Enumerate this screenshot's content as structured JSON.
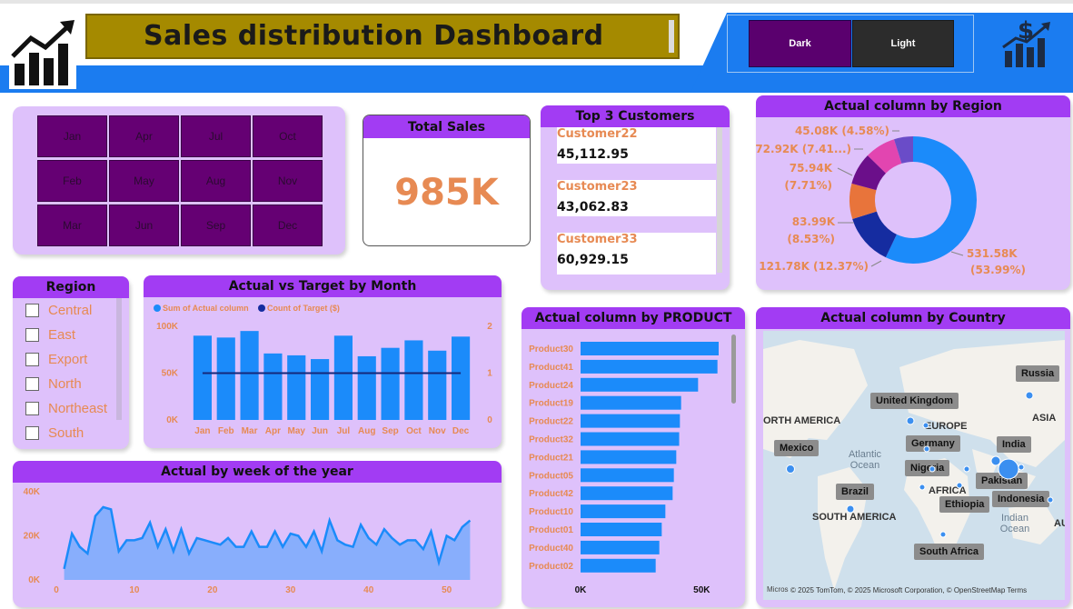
{
  "header": {
    "title": "Sales distribution Dashboard",
    "theme_dark": "Dark",
    "theme_light": "Light"
  },
  "colors": {
    "accent": "#a23cf3",
    "panel": "#dec1fb",
    "month_tile": "#650073",
    "bar": "#1b8bfa",
    "label": "#e78a53",
    "title_bar": "#a58a00"
  },
  "months": {
    "cols": [
      [
        "Jan",
        "Feb",
        "Mar"
      ],
      [
        "Apr",
        "May",
        "Jun"
      ],
      [
        "Jul",
        "Aug",
        "Sep"
      ],
      [
        "Oct",
        "Nov",
        "Dec"
      ]
    ]
  },
  "total_sales": {
    "title": "Total Sales",
    "value": "985K"
  },
  "top_customers": {
    "title": "Top 3 Customers",
    "items": [
      {
        "name": "Customer22",
        "value": "45,112.95"
      },
      {
        "name": "Customer23",
        "value": "43,062.83"
      },
      {
        "name": "Customer33",
        "value": "60,929.15"
      }
    ]
  },
  "region_slicer": {
    "title": "Region",
    "items": [
      "Central",
      "East",
      "Export",
      "North",
      "Northeast",
      "South"
    ]
  },
  "region_donut": {
    "title": "Actual column by Region",
    "labels": [
      "45.08K (4.58%)",
      "72.92K (7.41...)",
      "75.94K",
      "(7.71%)",
      "83.99K",
      "(8.53%)",
      "121.78K (12.37%)",
      "531.58K",
      "(53.99%)"
    ]
  },
  "product_chart": {
    "title": "Actual column by PRODUCT"
  },
  "country_map": {
    "title": "Actual column by Country",
    "countries": [
      "Russia",
      "United Kingdom",
      "Germany",
      "India",
      "Mexico",
      "Nigeria",
      "Pakistan",
      "Indonesia",
      "Brazil",
      "Ethiopia",
      "South Africa"
    ],
    "regions": [
      "ORTH AMERICA",
      "EUROPE",
      "ASIA",
      "AFRICA",
      "SOUTH AMERICA",
      "AU"
    ],
    "oceans": [
      "Atlantic Ocean",
      "Indian Ocean"
    ],
    "attribution": "© 2025 TomTom, © 2025 Microsoft Corporation, © OpenStreetMap  Terms",
    "brand": "Micros"
  },
  "chart_data": [
    {
      "type": "bar",
      "title": "Actual vs Target by Month",
      "legend": [
        "Sum of Actual column",
        "Count of Target ($)"
      ],
      "categories": [
        "Jan",
        "Feb",
        "Mar",
        "Apr",
        "May",
        "Jun",
        "Jul",
        "Aug",
        "Sep",
        "Oct",
        "Nov",
        "Dec"
      ],
      "series": [
        {
          "name": "Sum of Actual column",
          "values": [
            90,
            88,
            95,
            71,
            69,
            65,
            90,
            68,
            77,
            85,
            74,
            89
          ]
        },
        {
          "name": "Count of Target ($)",
          "values": [
            1,
            1,
            1,
            1,
            1,
            1,
            1,
            1,
            1,
            1,
            1,
            1
          ]
        }
      ],
      "y_ticks": [
        "100K",
        "50K",
        "0K"
      ],
      "y2_ticks": [
        "2",
        "1",
        "0"
      ],
      "ylim": [
        0,
        100
      ],
      "y2lim": [
        0,
        2
      ]
    },
    {
      "type": "area",
      "title": "Actual by week of the year",
      "x": [
        1,
        2,
        3,
        4,
        5,
        6,
        7,
        8,
        9,
        10,
        11,
        12,
        13,
        14,
        15,
        16,
        17,
        18,
        19,
        20,
        21,
        22,
        23,
        24,
        25,
        26,
        27,
        28,
        29,
        30,
        31,
        32,
        33,
        34,
        35,
        36,
        37,
        38,
        39,
        40,
        41,
        42,
        43,
        44,
        45,
        46,
        47,
        48,
        49,
        50,
        51,
        52,
        53
      ],
      "values": [
        5,
        21,
        15,
        12,
        29,
        33,
        32,
        13,
        18,
        18,
        19,
        26,
        15,
        23,
        13,
        23,
        12,
        19,
        18,
        17,
        16,
        19,
        15,
        15,
        22,
        15,
        15,
        22,
        15,
        21,
        20,
        15,
        22,
        13,
        27,
        18,
        16,
        15,
        25,
        19,
        16,
        23,
        19,
        16,
        18,
        18,
        14,
        22,
        8,
        20,
        18,
        24,
        27
      ],
      "x_ticks": [
        "0",
        "10",
        "20",
        "30",
        "40",
        "50"
      ],
      "y_ticks": [
        "40K",
        "20K",
        "0K"
      ],
      "ylim": [
        0,
        40
      ],
      "xlim": [
        0,
        54
      ]
    },
    {
      "type": "bar",
      "title": "Actual column by PRODUCT",
      "categories": [
        "Product30",
        "Product41",
        "Product24",
        "Product19",
        "Product22",
        "Product32",
        "Product21",
        "Product05",
        "Product42",
        "Product10",
        "Product01",
        "Product40",
        "Product02"
      ],
      "values": [
        57,
        56.5,
        48.5,
        41.5,
        41,
        40.7,
        39.5,
        38.5,
        38,
        35,
        33.5,
        32.5,
        31
      ],
      "x_ticks": [
        "0K",
        "50K"
      ],
      "xlim": [
        0,
        60
      ]
    },
    {
      "type": "pie",
      "title": "Actual column by Region",
      "values": [
        531.58,
        121.78,
        83.99,
        75.94,
        72.92,
        45.08
      ],
      "colors": [
        "#1b8bfa",
        "#152ca0",
        "#e8743b",
        "#6b0f8a",
        "#e245b0",
        "#6a4cc8"
      ]
    }
  ]
}
